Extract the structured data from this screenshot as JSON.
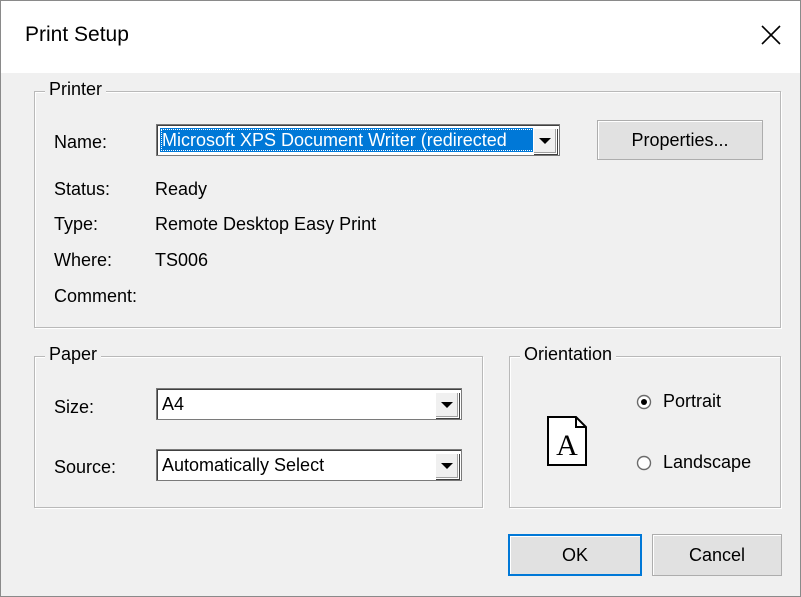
{
  "window": {
    "title": "Print Setup",
    "close_glyph": "close-icon"
  },
  "printer": {
    "group_label": "Printer",
    "name_label": "Name:",
    "name_value": "Microsoft XPS Document Writer (redirected",
    "properties_button": "Properties...",
    "status_label": "Status:",
    "status_value": "Ready",
    "type_label": "Type:",
    "type_value": "Remote Desktop Easy Print",
    "where_label": "Where:",
    "where_value": "TS006",
    "comment_label": "Comment:",
    "comment_value": ""
  },
  "paper": {
    "group_label": "Paper",
    "size_label": "Size:",
    "size_value": "A4",
    "source_label": "Source:",
    "source_value": "Automatically Select"
  },
  "orientation": {
    "group_label": "Orientation",
    "page_letter": "A",
    "options": [
      {
        "label": "Portrait",
        "selected": true
      },
      {
        "label": "Landscape",
        "selected": false
      }
    ]
  },
  "footer": {
    "ok_label": "OK",
    "cancel_label": "Cancel"
  },
  "colors": {
    "selection": "#0078d7",
    "dialog_background": "#f0f0f0",
    "title_background": "#ffffff"
  }
}
